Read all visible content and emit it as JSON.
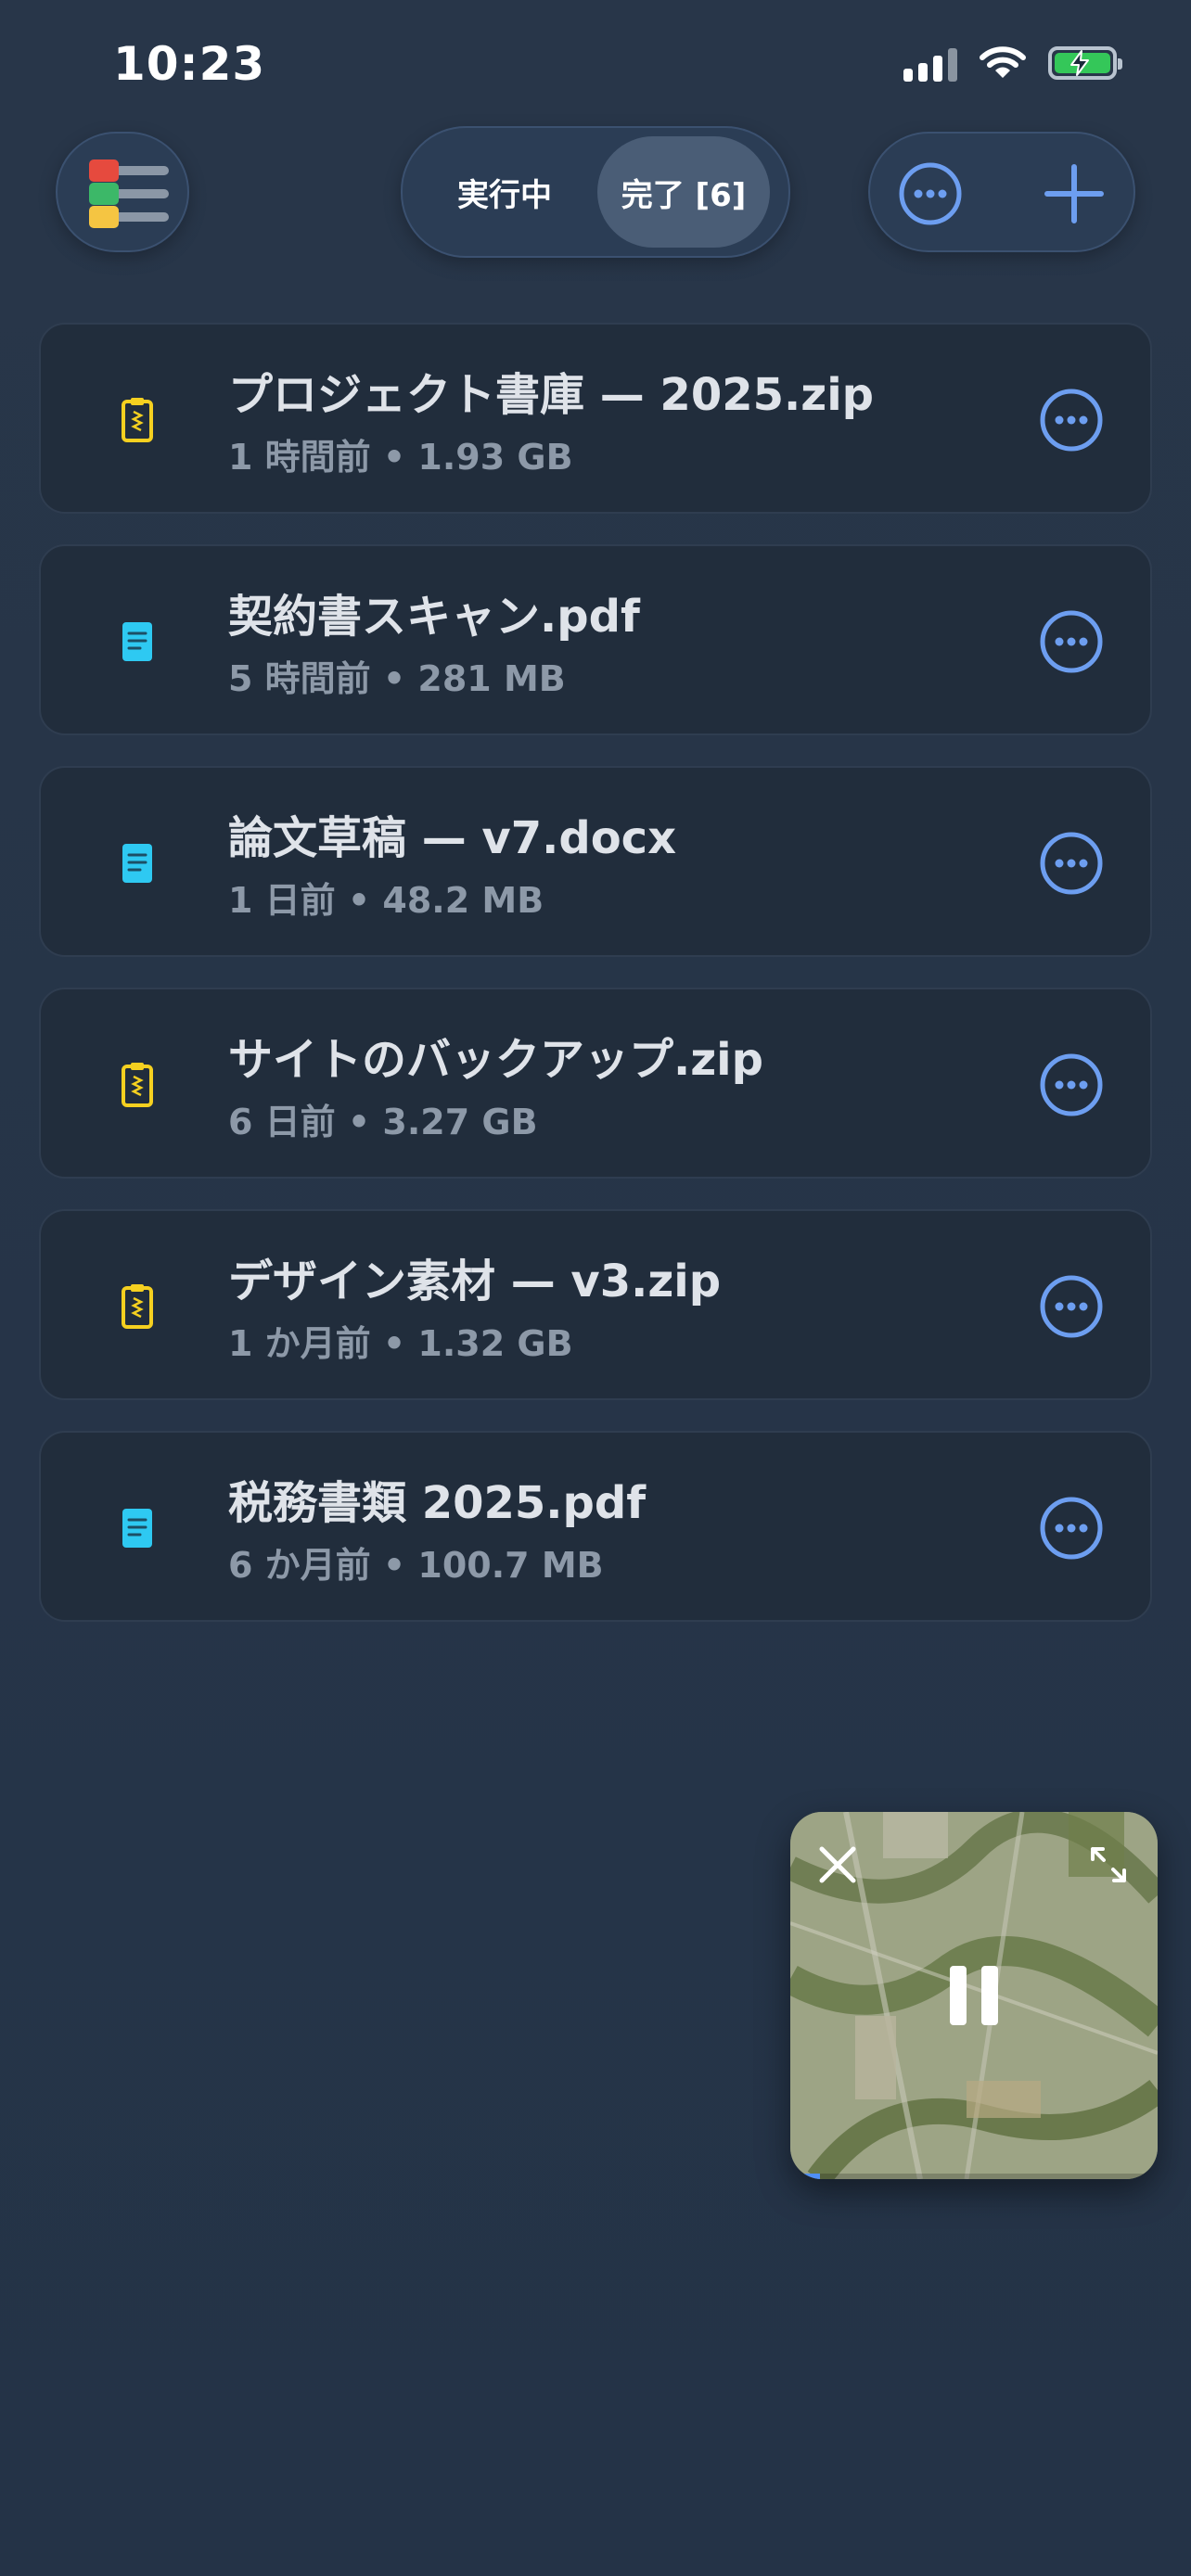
{
  "status_bar": {
    "time": "10:23",
    "icons": [
      "signal-icon",
      "wifi-icon",
      "battery-charging-icon"
    ]
  },
  "header": {
    "menu_icon": "color-list-icon",
    "tabs": [
      {
        "label": "実行中",
        "selected": false
      },
      {
        "label": "完了 [6]",
        "selected": true
      }
    ],
    "more_icon": "more-circle-icon",
    "add_icon": "plus-icon"
  },
  "files": [
    {
      "name": "プロジェクト書庫 — 2025.zip",
      "meta": "1 時間前 • 1.93 GB",
      "icon": "zip-file-icon"
    },
    {
      "name": "契約書スキャン.pdf",
      "meta": "5 時間前 • 281 MB",
      "icon": "document-icon"
    },
    {
      "name": "論文草稿 — v7.docx",
      "meta": "1 日前 • 48.2 MB",
      "icon": "document-icon"
    },
    {
      "name": "サイトのバックアップ.zip",
      "meta": "6 日前 • 3.27 GB",
      "icon": "zip-file-icon"
    },
    {
      "name": "デザイン素材 — v3.zip",
      "meta": "1 か月前 • 1.32 GB",
      "icon": "zip-file-icon"
    },
    {
      "name": "税務書類 2025.pdf",
      "meta": "6 か月前 • 100.7 MB",
      "icon": "document-icon"
    }
  ],
  "pip_player": {
    "state": "playing",
    "progress": 0.08
  },
  "colors": {
    "background": "#283649",
    "card": "#212d3c",
    "accent": "#6d9ef0",
    "zip_icon": "#f5d020",
    "doc_icon": "#2ec9f2"
  }
}
